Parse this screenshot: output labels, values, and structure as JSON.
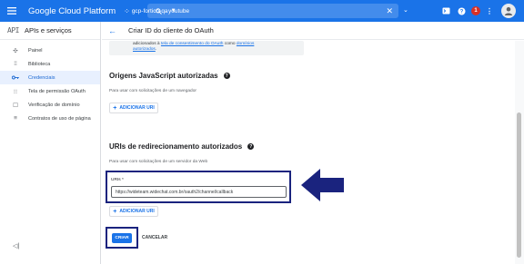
{
  "topbar": {
    "brand": "Google Cloud Platform",
    "project": "gcp-fortico-qa",
    "search_value": "youtube",
    "notifications_count": "1",
    "color": "#1a73e8"
  },
  "sidebar": {
    "logo": "API",
    "title": "APIs e serviços",
    "items": [
      {
        "label": "Painel",
        "icon": "dashboard-icon"
      },
      {
        "label": "Biblioteca",
        "icon": "library-icon"
      },
      {
        "label": "Credenciais",
        "icon": "key-icon",
        "active": true
      },
      {
        "label": "Tela de permissão OAuth",
        "icon": "consent-icon"
      },
      {
        "label": "Verificação de domínio",
        "icon": "domain-icon"
      },
      {
        "label": "Contratos de uso de página",
        "icon": "settings-list-icon"
      }
    ],
    "collapse_glyph": "◁|"
  },
  "header": {
    "title": "Criar ID do cliente do OAuth"
  },
  "content": {
    "info_line1_a": "adicionados à ",
    "info_link1": "tela de consentimento do OAuth",
    "info_line1_b": " como ",
    "info_link2": "domínios",
    "info_link3": "autorizados",
    "info_line2_b": ".",
    "js_title": "Origens JavaScript autorizadas",
    "js_desc": "Para usar com solicitações de um navegador",
    "add_uri_label": "ADICIONAR URI",
    "redirect_title": "URIs de redirecionamento autorizados",
    "redirect_desc": "Para usar com solicitações de um servidor da Web",
    "uri_label": "URIs *",
    "uri_value": "https://wideteam.widechat.com.br/oauth2/channel/callback",
    "add_uri_label_2": "ADICIONAR URI",
    "create_label": "CRIAR",
    "cancel_label": "CANCELAR"
  },
  "annotation_color": "#1a237e"
}
